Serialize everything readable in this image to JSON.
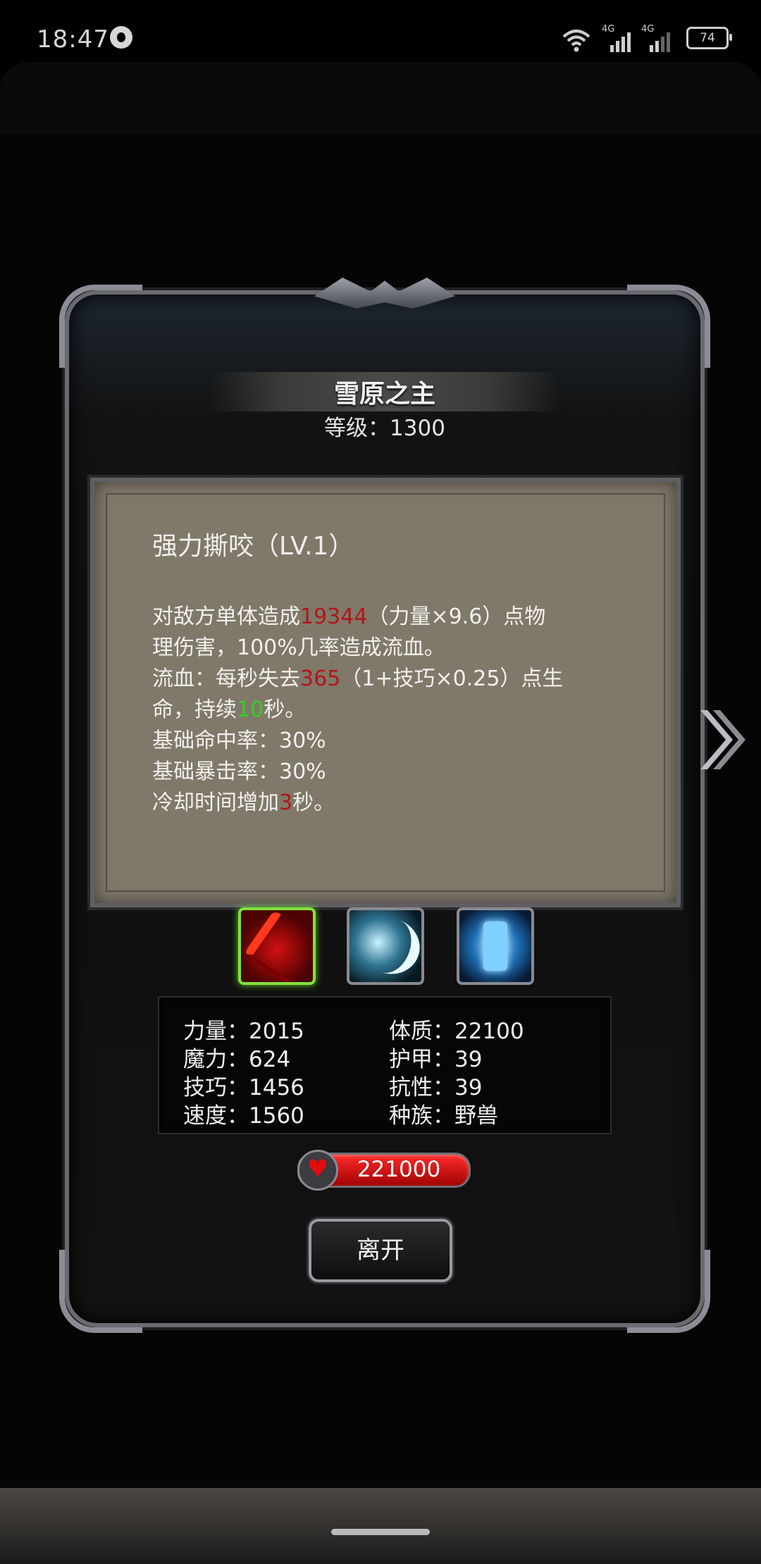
{
  "status_bar": {
    "time": "18:47",
    "sim1_label": "4G",
    "sim2_label": "4G",
    "battery_level": "74"
  },
  "dialog": {
    "title": "雪原之主",
    "level_text": "等级：1300",
    "skill": {
      "name": "强力撕咬（LV.1）",
      "desc": {
        "l1_a": "对敌方单体造成",
        "l1_dmg": "19344",
        "l1_b": "（力量×9.6）点物",
        "l2": "理伤害，100%几率造成流血。",
        "l3_a": "流血：每秒失去",
        "l3_hp": "365",
        "l3_b": "（1+技巧×0.25）点生",
        "l4_a": "命，持续",
        "l4_sec": "10",
        "l4_b": "秒。",
        "l5": "基础命中率：30%",
        "l6": "基础暴击率：30%",
        "l7_a": "冷却时间增加",
        "l7_cd": "3",
        "l7_b": "秒。"
      }
    },
    "skill_icons": [
      {
        "name": "bite-skill",
        "selected": true
      },
      {
        "name": "crescent-slash-skill",
        "selected": false
      },
      {
        "name": "ice-totem-skill",
        "selected": false
      }
    ],
    "stats": {
      "strength": "力量：2015",
      "magic": "魔力：624",
      "skill": "技巧：1456",
      "speed": "速度：1560",
      "constitution": "体质：22100",
      "armor": "护甲：39",
      "resist": "抗性：39",
      "race": "种族：野兽"
    },
    "hp": "221000",
    "leave_label": "离开"
  },
  "colors": {
    "damage_red": "#b0161a",
    "duration_green": "#34d11c",
    "hp_red": "#e10c0c",
    "selected_border": "#7fe23d"
  }
}
